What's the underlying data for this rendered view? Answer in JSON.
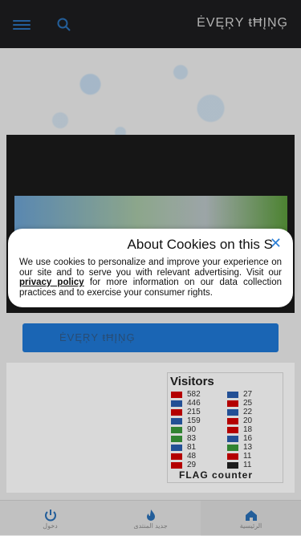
{
  "header": {
    "brand": "ĖVĘŖY ŧĦĮŅĢ"
  },
  "main": {
    "button_label": "ĖVĘŖY ŧĦĮŅĢ"
  },
  "visitors": {
    "title": "Visitors",
    "left": [
      "582",
      "446",
      "215",
      "159",
      "90",
      "83",
      "81",
      "48",
      "29"
    ],
    "right": [
      "27",
      "25",
      "22",
      "20",
      "18",
      "16",
      "13",
      "11",
      "11"
    ],
    "footer": "FLAG counter"
  },
  "bottom_nav": {
    "tabs": [
      {
        "label": "دخول"
      },
      {
        "label": "جديد المنتدى"
      },
      {
        "label": "الرئيسية"
      }
    ]
  },
  "cookie": {
    "title": "About Cookies on this S",
    "body_part1": "We use cookies to personalize and improve your experience on our site and to serve you with relevant advertising. Visit our ",
    "link": "privacy policy",
    "body_part2": " for more information on our data collection practices and to exercise your consumer rights."
  },
  "colors": {
    "header_bg": "#1d1d1f",
    "accent": "#1f77d4",
    "close": "#2c7fd6"
  }
}
